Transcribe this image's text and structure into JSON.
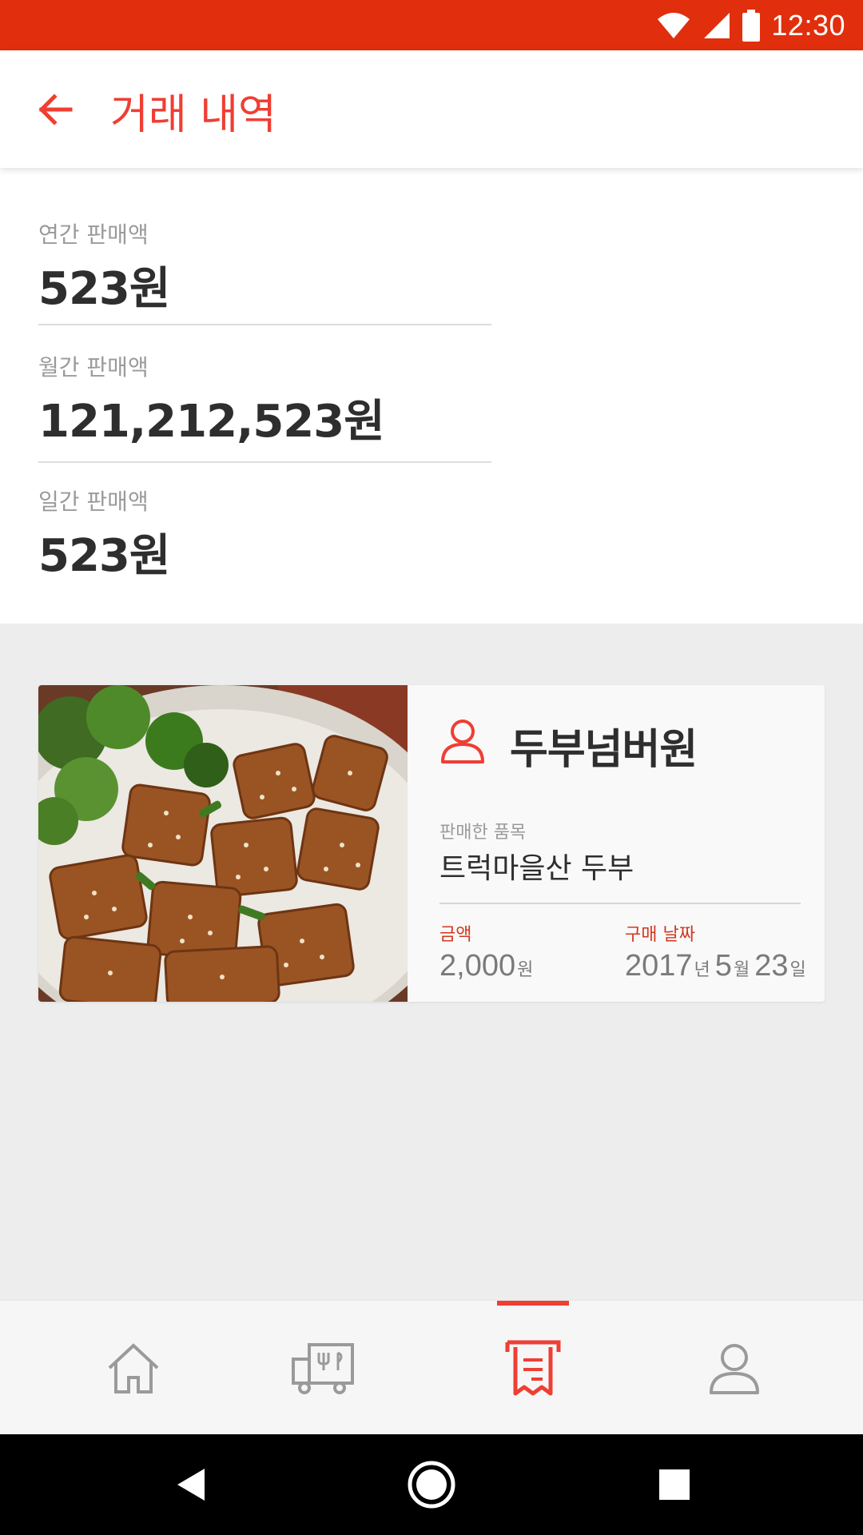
{
  "status_bar": {
    "time": "12:30",
    "icons": [
      "wifi-icon",
      "signal-icon",
      "battery-icon"
    ]
  },
  "header": {
    "title": "거래 내역",
    "back_icon": "arrow-back-icon"
  },
  "summary": {
    "yearly": {
      "label": "연간 판매액",
      "value": "523원"
    },
    "monthly": {
      "label": "월간 판매액",
      "value": "121,212,523원"
    },
    "daily": {
      "label": "일간 판매액",
      "value": "523원"
    }
  },
  "transactions": [
    {
      "image": "fried-tofu-photo",
      "seller_icon": "user-icon",
      "seller_name": "두부넘버원",
      "item_label": "판매한 품목",
      "item_name": "트럭마을산 두부",
      "price_label": "금액",
      "price_amount": "2,000",
      "price_unit": "원",
      "date_label": "구매 날짜",
      "date_year": "2017",
      "date_year_unit": "년",
      "date_month": "5",
      "date_month_unit": "월",
      "date_day": "23",
      "date_day_unit": "일"
    }
  ],
  "bottom_nav": {
    "items": [
      {
        "icon": "home-icon",
        "active": false
      },
      {
        "icon": "food-truck-icon",
        "active": false
      },
      {
        "icon": "receipt-icon",
        "active": true
      },
      {
        "icon": "profile-icon",
        "active": false
      }
    ]
  },
  "system_nav": [
    "back-triangle-icon",
    "home-circle-icon",
    "recents-square-icon"
  ],
  "colors": {
    "status_bar": "#e12e0c",
    "accent": "#ef3e33",
    "label_red": "#d0391f",
    "list_bg": "#ededed"
  }
}
